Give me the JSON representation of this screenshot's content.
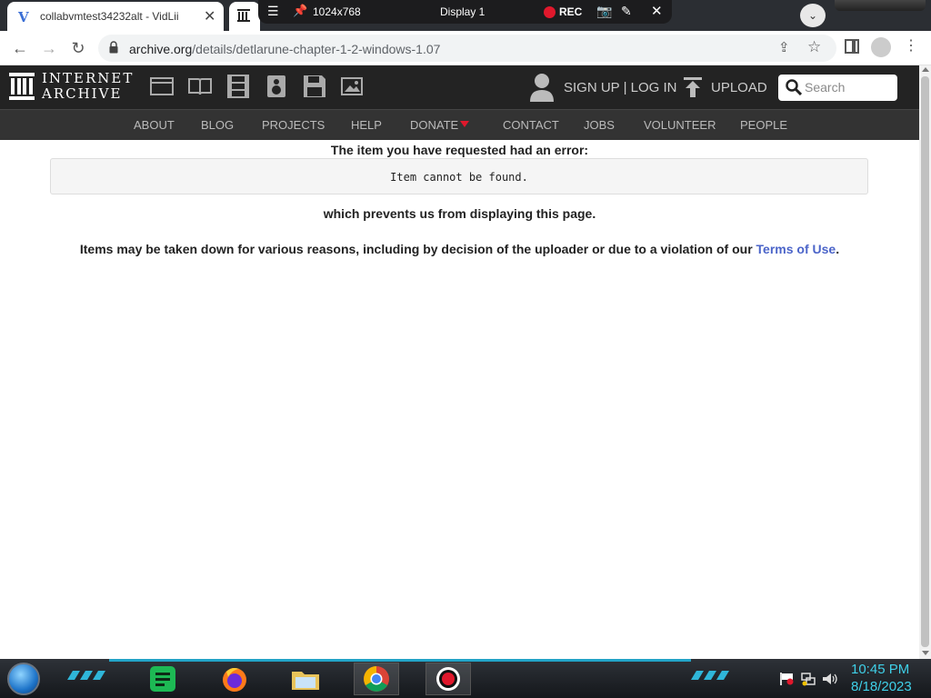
{
  "browser": {
    "active_tab_title": "collabvmtest34232alt - VidLii",
    "active_tab_close": "✕",
    "url_domain": "archive.org",
    "url_path": "/details/detlarune-chapter-1-2-windows-1.07"
  },
  "vnc_toolbar": {
    "resolution": "1024x768",
    "display": "Display 1",
    "rec_label": "REC",
    "accent_color": "#3b8cff",
    "rec_color": "#e0182c"
  },
  "site": {
    "logo_line1": "INTERNET",
    "logo_line2": "ARCHIVE",
    "signin": "SIGN UP | LOG IN",
    "upload": "UPLOAD",
    "search_placeholder": "Search",
    "media_icons": [
      "web-icon",
      "texts-icon",
      "video-icon",
      "audio-icon",
      "software-icon",
      "images-icon"
    ],
    "nav": [
      "ABOUT",
      "BLOG",
      "PROJECTS",
      "HELP",
      "DONATE",
      "CONTACT",
      "JOBS",
      "VOLUNTEER",
      "PEOPLE"
    ]
  },
  "content": {
    "heading": "The item you have requested had an error:",
    "error_message": "Item cannot be found.",
    "prevents": "which prevents us from displaying this page.",
    "reasons_prefix": "Items may be taken down for various reasons, including by decision of the uploader or due to a violation of our ",
    "tos_link": "Terms of Use",
    "reasons_suffix": ".",
    "link_color": "#4b64c9"
  },
  "taskbar": {
    "apps": [
      "start-orb",
      "notes-app-icon",
      "firefox-icon",
      "file-explorer-icon",
      "chrome-icon",
      "obs-record-icon"
    ],
    "time": "10:45 PM",
    "date": "8/18/2023",
    "clock_color": "#3fd0e8"
  }
}
